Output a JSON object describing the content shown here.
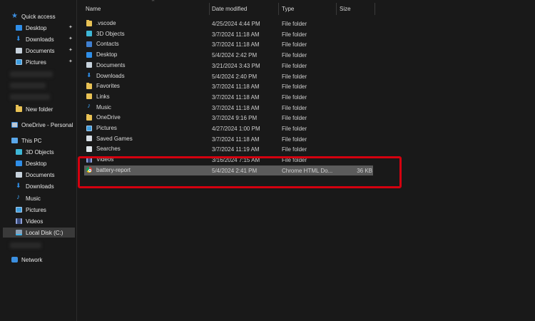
{
  "sidebar": {
    "quick_access": "Quick access",
    "quick_items": [
      {
        "label": "Desktop",
        "pinned": true
      },
      {
        "label": "Downloads",
        "pinned": true
      },
      {
        "label": "Documents",
        "pinned": true
      },
      {
        "label": "Pictures",
        "pinned": true
      }
    ],
    "new_folder": "New folder",
    "onedrive": "OneDrive - Personal",
    "this_pc": "This PC",
    "pc_items": [
      "3D Objects",
      "Desktop",
      "Documents",
      "Downloads",
      "Music",
      "Pictures",
      "Videos",
      "Local Disk (C:)"
    ],
    "network": "Network",
    "pin_glyph": "📌"
  },
  "columns": {
    "name": "Name",
    "date": "Date modified",
    "type": "Type",
    "size": "Size"
  },
  "files": [
    {
      "name": ".vscode",
      "date": "4/25/2024 4:44 PM",
      "type": "File folder",
      "size": "",
      "icon": "folder-icon"
    },
    {
      "name": "3D Objects",
      "date": "3/7/2024 11:18 AM",
      "type": "File folder",
      "size": "",
      "icon": "3d-objects-icon"
    },
    {
      "name": "Contacts",
      "date": "3/7/2024 11:18 AM",
      "type": "File folder",
      "size": "",
      "icon": "contacts-icon"
    },
    {
      "name": "Desktop",
      "date": "5/4/2024 2:42 PM",
      "type": "File folder",
      "size": "",
      "icon": "desktop-icon"
    },
    {
      "name": "Documents",
      "date": "3/21/2024 3:43 PM",
      "type": "File folder",
      "size": "",
      "icon": "documents-icon"
    },
    {
      "name": "Downloads",
      "date": "5/4/2024 2:40 PM",
      "type": "File folder",
      "size": "",
      "icon": "downloads-icon"
    },
    {
      "name": "Favorites",
      "date": "3/7/2024 11:18 AM",
      "type": "File folder",
      "size": "",
      "icon": "favorites-icon"
    },
    {
      "name": "Links",
      "date": "3/7/2024 11:18 AM",
      "type": "File folder",
      "size": "",
      "icon": "links-icon"
    },
    {
      "name": "Music",
      "date": "3/7/2024 11:18 AM",
      "type": "File folder",
      "size": "",
      "icon": "music-icon"
    },
    {
      "name": "OneDrive",
      "date": "3/7/2024 9:16 PM",
      "type": "File folder",
      "size": "",
      "icon": "onedrive-icon"
    },
    {
      "name": "Pictures",
      "date": "4/27/2024 1:00 PM",
      "type": "File folder",
      "size": "",
      "icon": "pictures-icon"
    },
    {
      "name": "Saved Games",
      "date": "3/7/2024 11:18 AM",
      "type": "File folder",
      "size": "",
      "icon": "saved-games-icon"
    },
    {
      "name": "Searches",
      "date": "3/7/2024 11:19 AM",
      "type": "File folder",
      "size": "",
      "icon": "searches-icon"
    },
    {
      "name": "Videos",
      "date": "3/16/2024 7:15 AM",
      "type": "File folder",
      "size": "",
      "icon": "videos-icon"
    },
    {
      "name": "battery-report",
      "date": "5/4/2024 2:41 PM",
      "type": "Chrome HTML Do...",
      "size": "36 KB",
      "icon": "chrome-html-icon",
      "selected": true
    }
  ],
  "colors": {
    "background": "#191919",
    "selected_row": "#5b5b5b",
    "highlight_box": "#d4000f"
  }
}
